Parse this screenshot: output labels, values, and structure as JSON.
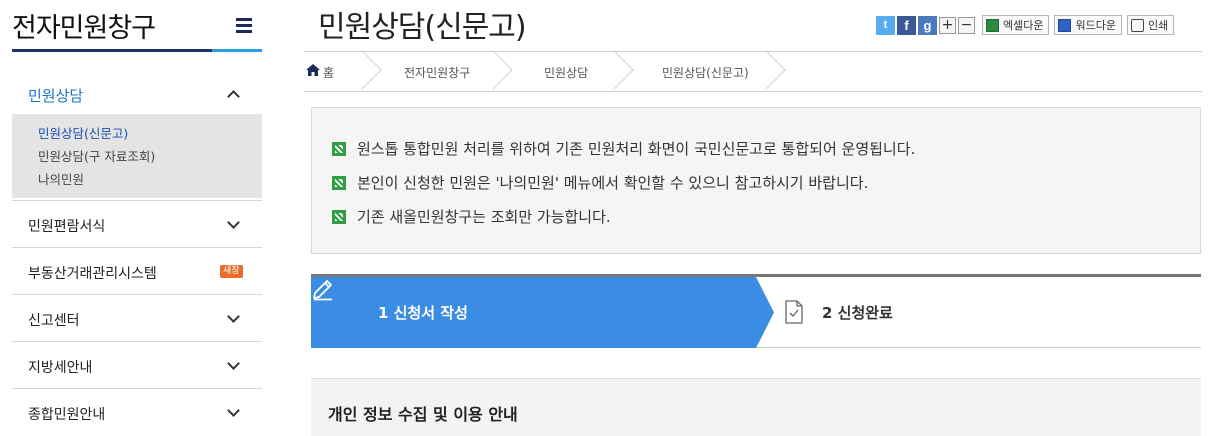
{
  "sidebar": {
    "title": "전자민원창구",
    "active_menu": "민원상담",
    "submenu": [
      "민원상담(신문고)",
      "민원상담(구 자료조회)",
      "나의민원"
    ],
    "items": [
      {
        "label": "민원편람서식"
      },
      {
        "label": "부동산거래관리시스템",
        "badge": "새창"
      },
      {
        "label": "신고센터"
      },
      {
        "label": "지방세안내"
      },
      {
        "label": "종합민원안내"
      }
    ]
  },
  "header": {
    "title": "민원상담(신문고)",
    "share": {
      "twitter": "t",
      "facebook": "f",
      "google": "g"
    },
    "zoom_in": "+",
    "zoom_out": "−",
    "excel_label": "엑셀다운",
    "word_label": "워드다운",
    "print_label": "인쇄"
  },
  "breadcrumb": [
    "홈",
    "전자민원창구",
    "민원상담",
    "민원상담(신문고)"
  ],
  "notice": [
    "원스톱 통합민원 처리를 위하여 기존 민원처리 화면이 국민신문고로 통합되어 운영됩니다.",
    "본인이 신청한 민원은 '나의민원' 메뉴에서 확인할 수 있으니 참고하시기 바랍니다.",
    "기존 새올민원창구는 조회만 가능합니다."
  ],
  "steps": [
    {
      "label": "1 신청서 작성",
      "active": true
    },
    {
      "label": "2 신청완료",
      "active": false
    }
  ],
  "section": {
    "title": "개인 정보 수집 및 이용 안내"
  },
  "colors": {
    "accent": "#3a8de2",
    "nav_dark": "#22336b",
    "link_active": "#1a73c8",
    "check_green": "#2f9e44"
  }
}
